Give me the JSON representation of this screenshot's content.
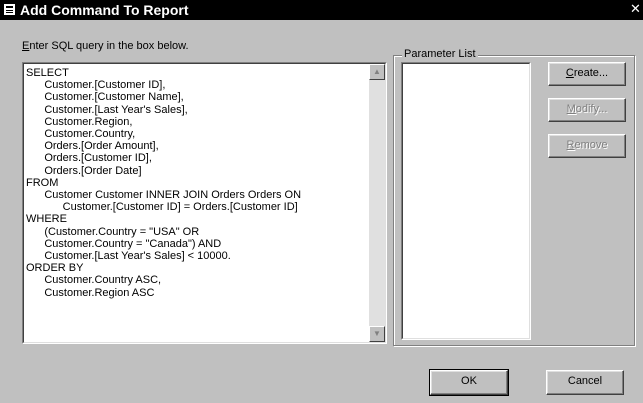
{
  "window": {
    "title": "Add Command To Report",
    "close_glyph": "✕",
    "title_icon": "dialog-icon"
  },
  "instruction": {
    "mnemonic": "E",
    "rest": "nter SQL query in the box below."
  },
  "sql_query": "SELECT\n      Customer.[Customer ID],\n      Customer.[Customer Name],\n      Customer.[Last Year's Sales],\n      Customer.Region,\n      Customer.Country,\n      Orders.[Order Amount],\n      Orders.[Customer ID],\n      Orders.[Order Date]\nFROM\n      Customer Customer INNER JOIN Orders Orders ON\n            Customer.[Customer ID] = Orders.[Customer ID]\nWHERE\n      (Customer.Country = \"USA\" OR\n      Customer.Country = \"Canada\") AND\n      Customer.[Last Year's Sales] < 10000.\nORDER BY\n      Customer.Country ASC,\n      Customer.Region ASC",
  "parameter_list": {
    "label": "Parameter List",
    "items": []
  },
  "buttons": {
    "create": {
      "mnemonic": "C",
      "rest": "reate...",
      "enabled": true
    },
    "modify": {
      "mnemonic": "M",
      "rest": "odify...",
      "enabled": false
    },
    "remove": {
      "mnemonic": "R",
      "rest": "emove",
      "enabled": false
    },
    "ok": "OK",
    "cancel": "Cancel"
  },
  "scrollbar": {
    "up_glyph": "▲",
    "down_glyph": "▼"
  },
  "colors": {
    "dialog_bg": "#c0c0c0",
    "titlebar_bg": "#000000",
    "titlebar_text": "#ffffff",
    "disabled_text": "#808080"
  }
}
